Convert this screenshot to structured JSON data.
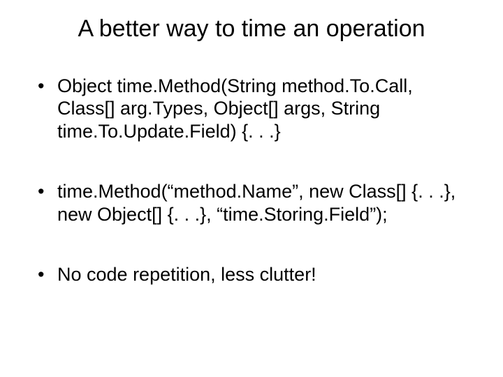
{
  "title": "A better way to time an operation",
  "bullets": [
    "Object time.Method(String method.To.Call, Class[] arg.Types, Object[] args, String time.To.Update.Field) {. . .}",
    "time.Method(“method.Name”, new Class[] {. . .}, new Object[] {. . .}, “time.Storing.Field”);",
    "No code repetition, less clutter!"
  ]
}
